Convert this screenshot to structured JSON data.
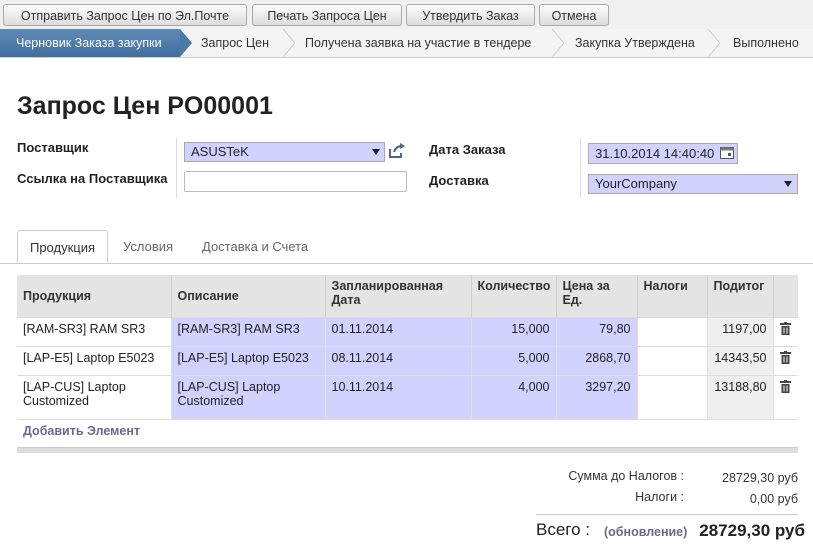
{
  "toolbar": {
    "send_rfq": "Отправить Запрос Цен по Эл.Почте",
    "print_rfq": "Печать Запроса Цен",
    "confirm_order": "Утвердить Заказ",
    "cancel": "Отмена"
  },
  "statusbar": {
    "stages": [
      "Черновик Заказа закупки",
      "Запрос Цен",
      "Получена заявка на участие в тендере",
      "Закупка Утверждена",
      "Выполнено"
    ],
    "active_index": 0
  },
  "form": {
    "title": "Запрос Цен PO00001",
    "supplier_label": "Поставщик",
    "supplier_value": "ASUSTeK",
    "supplier_ref_label": "Ссылка на Поставщика",
    "supplier_ref_value": "",
    "order_date_label": "Дата Заказа",
    "order_date_value": "31.10.2014 14:40:40",
    "delivery_label": "Доставка",
    "delivery_value": "YourCompany"
  },
  "tabs": [
    "Продукция",
    "Условия",
    "Доставка и Счета"
  ],
  "lines": {
    "headers": [
      "Продукция",
      "Описание",
      "Запланированная Дата",
      "Количество",
      "Цена за Ед.",
      "Налоги",
      "Подитог"
    ],
    "rows": [
      {
        "product": "[RAM-SR3] RAM SR3",
        "description": "[RAM-SR3] RAM SR3",
        "date": "01.11.2014",
        "qty": "15,000",
        "price": "79,80",
        "taxes": "",
        "subtotal": "1197,00"
      },
      {
        "product": "[LAP-E5] Laptop E5023",
        "description": "[LAP-E5] Laptop E5023",
        "date": "08.11.2014",
        "qty": "5,000",
        "price": "2868,70",
        "taxes": "",
        "subtotal": "14343,50"
      },
      {
        "product": "[LAP-CUS] Laptop Customized",
        "description": "[LAP-CUS] Laptop Customized",
        "date": "10.11.2014",
        "qty": "4,000",
        "price": "3297,20",
        "taxes": "",
        "subtotal": "13188,80"
      }
    ],
    "add_item": "Добавить Элемент"
  },
  "totals": {
    "untaxed_label": "Сумма до Налогов :",
    "untaxed_value": "28729,30 руб",
    "taxes_label": "Налоги :",
    "taxes_value": "0,00 руб",
    "total_label": "Всего :",
    "update_link": "(обновление)",
    "total_value": "28729,30 руб"
  },
  "icons": {
    "supplier_dropdown": "triangle-down-icon",
    "supplier_open": "external-link-icon",
    "date_picker": "calendar-icon",
    "delivery_dropdown": "triangle-down-icon",
    "row_delete": "trash-icon"
  },
  "colors": {
    "status_active": "#4a7aaa",
    "required_field": "#d2d2ff",
    "link": "#6a6a8e"
  }
}
